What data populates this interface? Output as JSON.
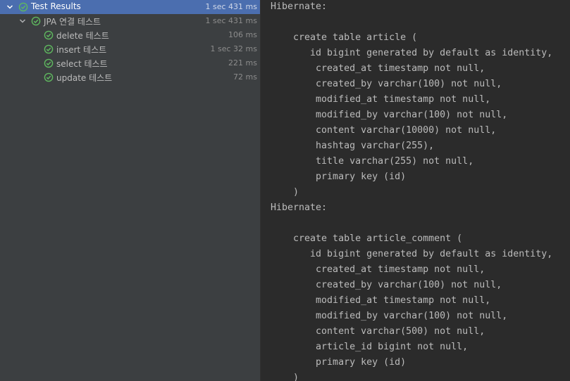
{
  "tree": [
    {
      "label": "Test Results",
      "duration": "1 sec 431 ms",
      "level": 0,
      "expanded": true,
      "selected": true,
      "status": "passed"
    },
    {
      "label": "JPA 연결 테스트",
      "duration": "1 sec 431 ms",
      "level": 1,
      "expanded": true,
      "selected": false,
      "status": "passed"
    },
    {
      "label": "delete 테스트",
      "duration": "106 ms",
      "level": 2,
      "selected": false,
      "status": "passed"
    },
    {
      "label": "insert 테스트",
      "duration": "1 sec 32 ms",
      "level": 2,
      "selected": false,
      "status": "passed"
    },
    {
      "label": "select 테스트",
      "duration": "221 ms",
      "level": 2,
      "selected": false,
      "status": "passed"
    },
    {
      "label": "update 테스트",
      "duration": "72 ms",
      "level": 2,
      "selected": false,
      "status": "passed"
    }
  ],
  "console": [
    "Hibernate: ",
    "",
    "    create table article (",
    "       id bigint generated by default as identity,",
    "        created_at timestamp not null,",
    "        created_by varchar(100) not null,",
    "        modified_at timestamp not null,",
    "        modified_by varchar(100) not null,",
    "        content varchar(10000) not null,",
    "        hashtag varchar(255),",
    "        title varchar(255) not null,",
    "        primary key (id)",
    "    )",
    "Hibernate: ",
    "",
    "    create table article_comment (",
    "       id bigint generated by default as identity,",
    "        created_at timestamp not null,",
    "        created_by varchar(100) not null,",
    "        modified_at timestamp not null,",
    "        modified_by varchar(100) not null,",
    "        content varchar(500) not null,",
    "        article_id bigint not null,",
    "        primary key (id)",
    "    )"
  ],
  "colors": {
    "passed": "#5fb85f",
    "selection": "#4b6eaf"
  },
  "icons": {
    "expand": "chevron-down-icon",
    "status": "check-circle-icon"
  }
}
